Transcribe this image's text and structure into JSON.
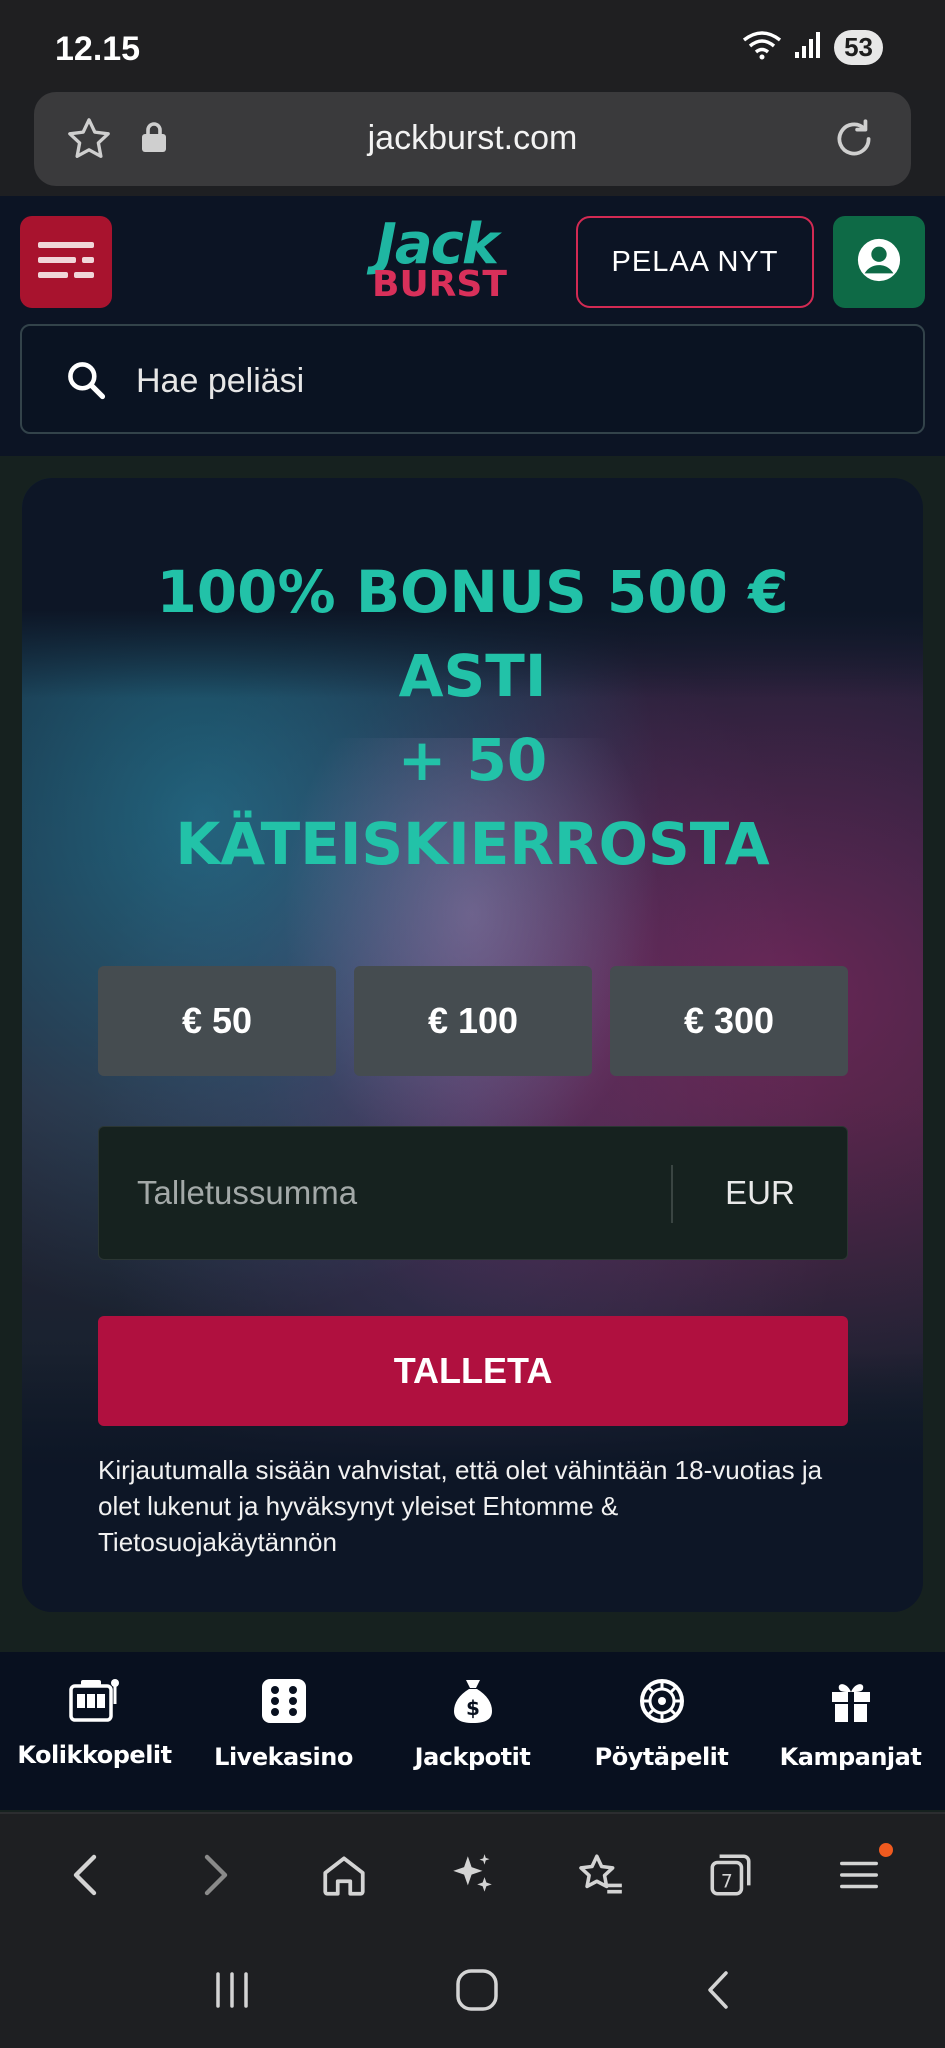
{
  "status_bar": {
    "time": "12.15",
    "battery": "53"
  },
  "browser": {
    "url": "jackburst.com"
  },
  "header": {
    "logo_top": "Jack",
    "logo_bottom": "BURST",
    "play_label": "PELAA NYT",
    "search_placeholder": "Hae peliäsi"
  },
  "promo": {
    "headline_lines": [
      "100% BONUS 500 €",
      "ASTI",
      "+ 50",
      "KÄTEISKIERROSTA"
    ],
    "amounts": [
      "€ 50",
      "€ 100",
      "€ 300"
    ],
    "deposit_placeholder": "Talletussumma",
    "currency": "EUR",
    "deposit_button": "TALLETA",
    "legal": "Kirjautumalla sisään vahvistat, että olet vähintään 18-vuotias ja olet lukenut ja hyväksynyt yleiset Ehtomme & Tietosuojakäytännön"
  },
  "site_nav": [
    {
      "label": "Kolikkopelit",
      "icon": "slot-machine-icon"
    },
    {
      "label": "Livekasino",
      "icon": "dice-icon"
    },
    {
      "label": "Jackpotit",
      "icon": "money-bag-icon"
    },
    {
      "label": "Pöytäpelit",
      "icon": "roulette-icon"
    },
    {
      "label": "Kampanjat",
      "icon": "gift-icon"
    }
  ],
  "browser_toolbar": {
    "tabs_count": "7"
  },
  "colors": {
    "brand_teal": "#22c2a8",
    "brand_red": "#b0103f",
    "account_green": "#0e6a46",
    "notification": "#f05a1f"
  }
}
